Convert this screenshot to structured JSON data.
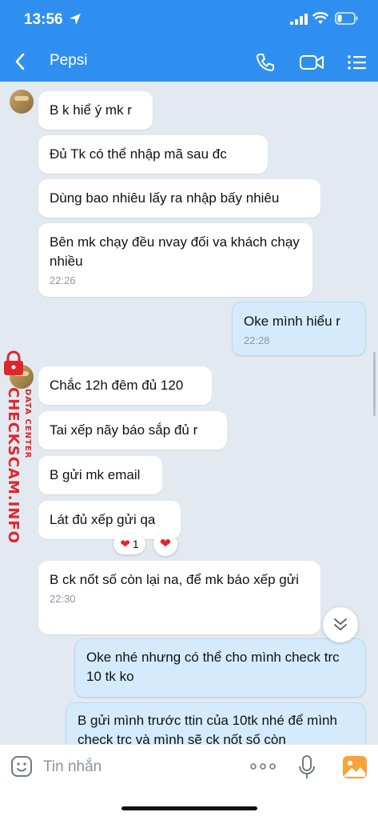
{
  "status": {
    "time": "13:56"
  },
  "header": {
    "title": "Pepsi"
  },
  "messages": [
    {
      "side": "them",
      "text": "B k hiể ý mk r"
    },
    {
      "side": "them",
      "text": "Đủ Tk có thể nhập mã sau đc"
    },
    {
      "side": "them",
      "text": "Dùng bao nhiêu lấy ra nhập bấy nhiêu"
    },
    {
      "side": "them",
      "text": "Bên mk chạy đều nvay đối va khách chạy nhiều",
      "time": "22:26"
    },
    {
      "side": "me",
      "text": "Oke mình hiểu r",
      "time": "22:28"
    },
    {
      "side": "them",
      "text": "Chắc 12h đêm đủ 120"
    },
    {
      "side": "them",
      "text": "Tai xếp nãy báo sắp đủ r"
    },
    {
      "side": "them",
      "text": "B gửi mk email"
    },
    {
      "side": "them",
      "text": "Lát đủ xếp gửi qa",
      "reaction_count": "1"
    },
    {
      "side": "them",
      "text": "B ck nốt số còn lại na, để mk báo xếp gửi",
      "time": "22:30"
    },
    {
      "side": "me",
      "text": "Oke nhé nhưng có thể cho mình check trc 10 tk ko"
    },
    {
      "side": "me",
      "text": "B gửi mình trước ttin của 10tk nhé để mình check trc và mình sẽ ck nốt số còn"
    }
  ],
  "watermark": {
    "line1": "DATA CENTER",
    "line2": "CHECKSCAM.INFO"
  },
  "composer": {
    "placeholder": "Tin nhắn"
  },
  "colors": {
    "brand": "#2f8ff0",
    "my_bubble": "#d5ebfb",
    "watermark": "#e0262b"
  }
}
